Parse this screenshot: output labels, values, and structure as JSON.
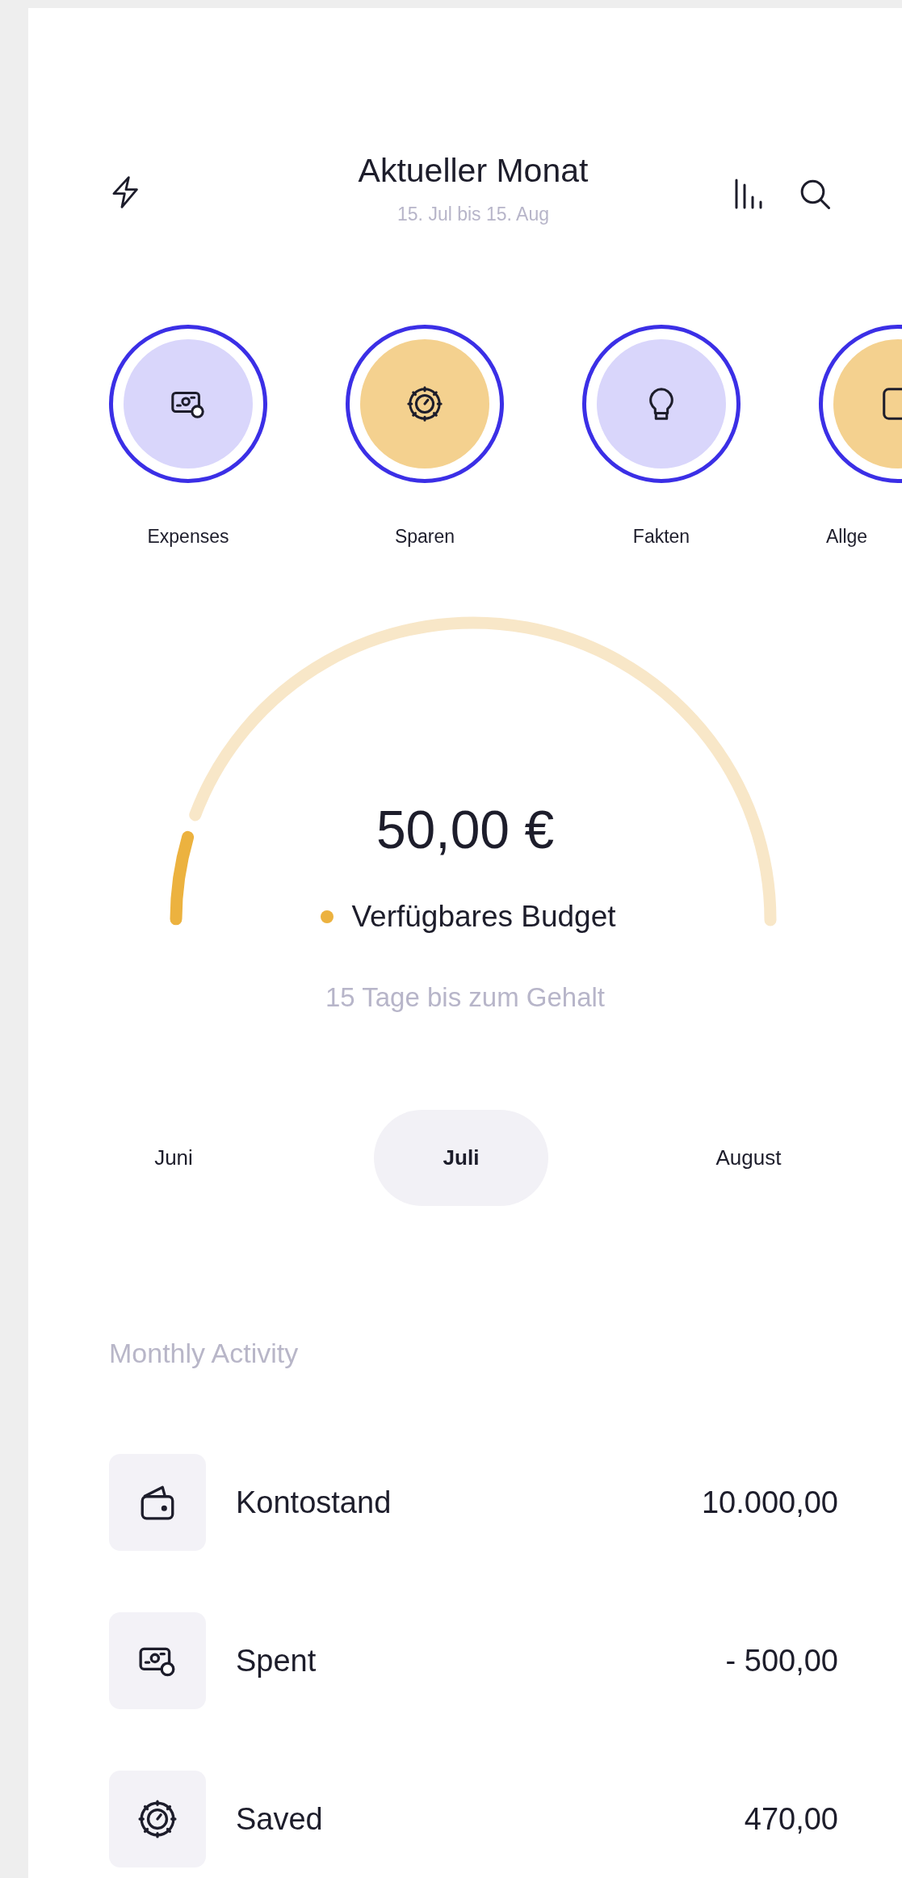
{
  "header": {
    "title": "Aktueller Monat",
    "subtitle": "15. Jul bis 15. Aug"
  },
  "categories": [
    {
      "label": "Expenses",
      "color": "#d9d6fb"
    },
    {
      "label": "Sparen",
      "color": "#f4d18f"
    },
    {
      "label": "Fakten",
      "color": "#d9d6fb"
    },
    {
      "label": "Allge",
      "color": "#f4d18f"
    }
  ],
  "budget": {
    "amount": "50,00 €",
    "label": "Verfügbares Budget",
    "note": "15 Tage bis zum Gehalt"
  },
  "months": [
    {
      "label": "Juni",
      "selected": false
    },
    {
      "label": "Juli",
      "selected": true
    },
    {
      "label": "August",
      "selected": false
    }
  ],
  "activity": {
    "title": "Monthly Activity",
    "rows": [
      {
        "label": "Kontostand",
        "amount": "10.000,00"
      },
      {
        "label": "Spent",
        "amount": "- 500,00"
      },
      {
        "label": "Saved",
        "amount": "470,00"
      }
    ]
  }
}
